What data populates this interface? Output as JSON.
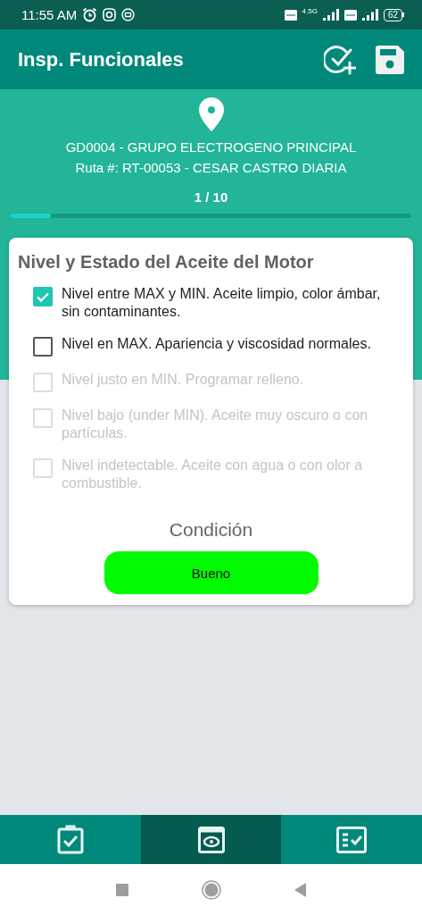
{
  "status_bar": {
    "time": "11:55 AM",
    "network": "4.5G",
    "battery": "62"
  },
  "app_bar": {
    "title": "Insp. Funcionales"
  },
  "header": {
    "equipment": "GD0004 - GRUPO ELECTROGENO PRINCIPAL",
    "route": "Ruta #: RT-00053 - CESAR CASTRO DIARIA",
    "counter": "1 / 10",
    "progress": {
      "level": 0.1
    }
  },
  "question": {
    "title": "Nivel y Estado del Aceite del Motor",
    "options": [
      {
        "label": "Nivel entre MAX y MIN. Aceite limpio, color ámbar, sin contaminantes.",
        "checked": true,
        "disabled": false
      },
      {
        "label": "Nivel en MAX. Apariencia y viscosidad normales.",
        "checked": false,
        "disabled": false
      },
      {
        "label": "Nivel justo en MIN. Programar relleno.",
        "checked": false,
        "disabled": true
      },
      {
        "label": "Nivel bajo (under MIN). Aceite muy oscuro o con partículas.",
        "checked": false,
        "disabled": true
      },
      {
        "label": "Nivel indetectable. Aceite con agua o con olor a combustible.",
        "checked": false,
        "disabled": true
      }
    ],
    "condition_label": "Condición",
    "condition_value": "Bueno"
  },
  "bottom_tabs": [
    {
      "kind": "clipboard",
      "selected": false
    },
    {
      "kind": "eye",
      "selected": true
    },
    {
      "kind": "checklist",
      "selected": false
    }
  ]
}
